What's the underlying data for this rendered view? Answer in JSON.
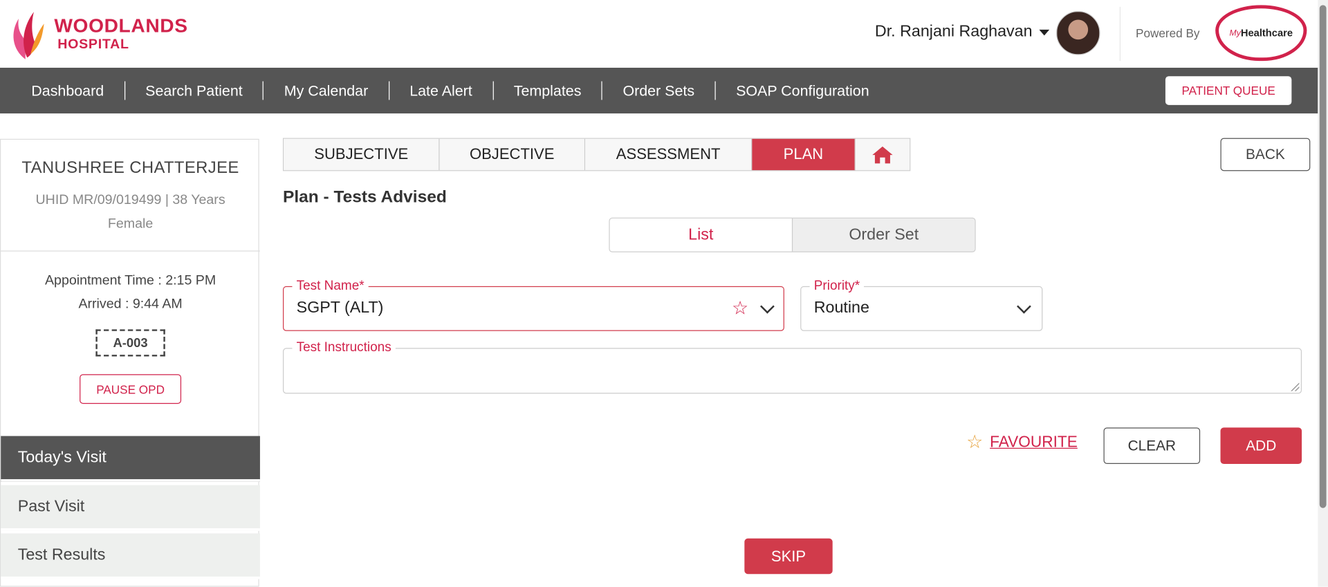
{
  "header": {
    "logo_line1": "WOODLANDS",
    "logo_line2": "HOSPITAL",
    "user_name": "Dr. Ranjani Raghavan",
    "powered_by": "Powered By",
    "partner_logo_my": "My",
    "partner_logo_text": "Healthcare"
  },
  "nav": {
    "items": [
      {
        "label": "Dashboard"
      },
      {
        "label": "Search Patient"
      },
      {
        "label": "My Calendar"
      },
      {
        "label": "Late Alert"
      },
      {
        "label": "Templates"
      },
      {
        "label": "Order Sets"
      },
      {
        "label": "SOAP Configuration"
      }
    ],
    "queue_button": "PATIENT QUEUE"
  },
  "patient": {
    "name": "TANUSHREE CHATTERJEE",
    "uhid_line": "UHID MR/09/019499 | 38 Years",
    "gender": "Female",
    "appointment": "Appointment Time : 2:15 PM",
    "arrived": "Arrived : 9:44 AM",
    "token": "A-003",
    "pause_button": "PAUSE OPD"
  },
  "sidebar": {
    "items": [
      {
        "label": "Today's Visit",
        "active": true
      },
      {
        "label": "Past Visit",
        "active": false
      },
      {
        "label": "Test Results",
        "active": false
      }
    ]
  },
  "soap_tabs": [
    {
      "label": "SUBJECTIVE",
      "active": false
    },
    {
      "label": "OBJECTIVE",
      "active": false
    },
    {
      "label": "ASSESSMENT",
      "active": false
    },
    {
      "label": "PLAN",
      "active": true
    },
    {
      "label": "",
      "icon": "home-icon"
    }
  ],
  "back_button": "BACK",
  "section_title": "Plan - Tests Advised",
  "toggle": {
    "list_label": "List",
    "orderset_label": "Order Set",
    "selected": "List"
  },
  "form": {
    "test_name_label": "Test Name*",
    "test_name_value": "SGPT (ALT)",
    "priority_label": "Priority*",
    "priority_value": "Routine",
    "instructions_label": "Test Instructions",
    "instructions_value": ""
  },
  "actions": {
    "favourite": "FAVOURITE",
    "clear": "CLEAR",
    "add": "ADD",
    "skip": "SKIP"
  },
  "colors": {
    "brand": "#d1224b",
    "accent_button": "#d13b4b",
    "nav_bg": "#555555",
    "favourite_star": "#e6a23c"
  }
}
